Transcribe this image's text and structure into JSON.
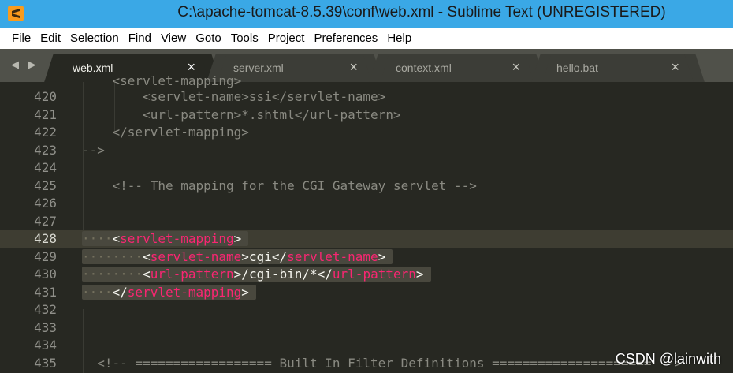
{
  "window": {
    "title": "C:\\apache-tomcat-8.5.39\\conf\\web.xml - Sublime Text (UNREGISTERED)",
    "app_icon": "sublime-text-icon",
    "titlebar_color": "#3aa8e6",
    "app_icon_color": "#f99b1d"
  },
  "menu": [
    "File",
    "Edit",
    "Selection",
    "Find",
    "View",
    "Goto",
    "Tools",
    "Project",
    "Preferences",
    "Help"
  ],
  "tab_nav": "◀ ▶",
  "tabs": [
    {
      "label": "web.xml",
      "active": true,
      "close": "×"
    },
    {
      "label": "server.xml",
      "active": false,
      "close": "×"
    },
    {
      "label": "context.xml",
      "active": false,
      "close": "×"
    },
    {
      "label": "hello.bat",
      "active": false,
      "close": "×"
    }
  ],
  "editor": {
    "background": "#272822",
    "tag_color": "#f92672",
    "partial_top_line": "    <servlet-mapping>",
    "lines": [
      {
        "num": "420",
        "text": "        <servlet-name>ssi</servlet-name>"
      },
      {
        "num": "421",
        "text": "        <url-pattern>*.shtml</url-pattern>"
      },
      {
        "num": "422",
        "text": "    </servlet-mapping>"
      },
      {
        "num": "423",
        "text": "-->"
      },
      {
        "num": "424",
        "text": ""
      },
      {
        "num": "425",
        "text": "    <!-- The mapping for the CGI Gateway servlet -->"
      },
      {
        "num": "426",
        "text": ""
      },
      {
        "num": "427",
        "text": ""
      },
      {
        "num": "428",
        "text": ""
      },
      {
        "num": "429",
        "text": ""
      },
      {
        "num": "430",
        "text": ""
      },
      {
        "num": "431",
        "text": ""
      },
      {
        "num": "432",
        "text": ""
      },
      {
        "num": "433",
        "text": ""
      },
      {
        "num": "434",
        "text": ""
      },
      {
        "num": "435",
        "text": "  <!-- ================== Built In Filter Definitions ===================== -->"
      }
    ],
    "selected": {
      "l428": {
        "ws": "····",
        "open": "<",
        "tag": "servlet-mapping",
        "close": ">"
      },
      "l429": {
        "ws": "········",
        "open": "<",
        "tag": "servlet-name",
        "mid": ">cgi</",
        "tag2": "servlet-name",
        "close": ">"
      },
      "l430": {
        "ws": "········",
        "open": "<",
        "tag": "url-pattern",
        "mid": ">/cgi-bin/*</",
        "tag2": "url-pattern",
        "close": ">"
      },
      "l431": {
        "ws": "····",
        "open": "</",
        "tag": "servlet-mapping",
        "close": ">"
      }
    }
  },
  "watermark": "CSDN @lainwith"
}
